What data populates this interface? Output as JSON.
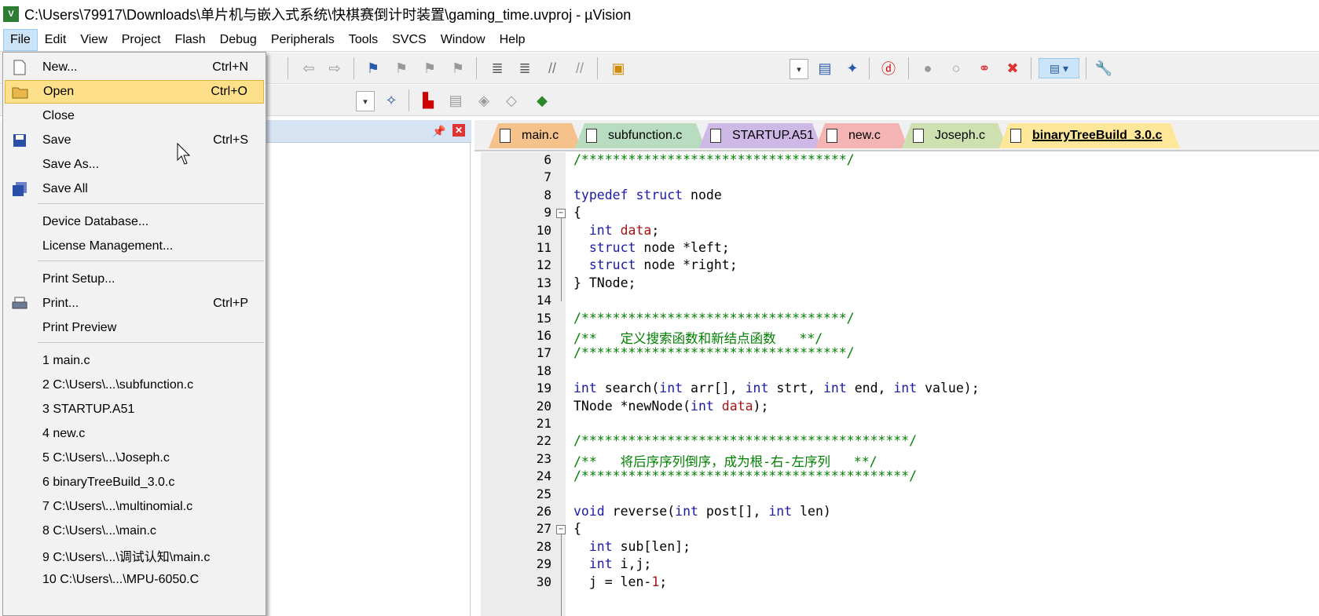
{
  "window": {
    "title": "C:\\Users\\79917\\Downloads\\单片机与嵌入式系统\\快棋赛倒计时装置\\gaming_time.uvproj - µVision",
    "app_icon": "V"
  },
  "menubar": [
    "File",
    "Edit",
    "View",
    "Project",
    "Flash",
    "Debug",
    "Peripherals",
    "Tools",
    "SVCS",
    "Window",
    "Help"
  ],
  "file_menu": {
    "items": [
      {
        "label": "New...",
        "shortcut": "Ctrl+N",
        "icon": "new-file-icon"
      },
      {
        "label": "Open",
        "shortcut": "Ctrl+O",
        "icon": "open-folder-icon",
        "highlighted": true
      },
      {
        "label": "Close",
        "shortcut": ""
      },
      {
        "label": "Save",
        "shortcut": "Ctrl+S",
        "icon": "save-icon"
      },
      {
        "label": "Save As...",
        "shortcut": ""
      },
      {
        "label": "Save All",
        "shortcut": "",
        "icon": "save-all-icon"
      },
      {
        "label": "Device Database...",
        "shortcut": ""
      },
      {
        "label": "License Management...",
        "shortcut": ""
      },
      {
        "label": "Print Setup...",
        "shortcut": ""
      },
      {
        "label": "Print...",
        "shortcut": "Ctrl+P",
        "icon": "printer-icon"
      },
      {
        "label": "Print Preview",
        "shortcut": ""
      },
      {
        "label": "1 main.c"
      },
      {
        "label": "2 C:\\Users\\...\\subfunction.c"
      },
      {
        "label": "3 STARTUP.A51"
      },
      {
        "label": "4 new.c"
      },
      {
        "label": "5 C:\\Users\\...\\Joseph.c"
      },
      {
        "label": "6 binaryTreeBuild_3.0.c"
      },
      {
        "label": "7 C:\\Users\\...\\multinomial.c"
      },
      {
        "label": "8 C:\\Users\\...\\main.c"
      },
      {
        "label": "9 C:\\Users\\...\\调试认知\\main.c"
      },
      {
        "label": "10 C:\\Users\\...\\MPU-6050.C"
      }
    ]
  },
  "editor": {
    "tabs": [
      {
        "label": "main.c",
        "color": "#f6c28b"
      },
      {
        "label": "subfunction.c",
        "color": "#b8dcc0"
      },
      {
        "label": "STARTUP.A51",
        "color": "#cdb8e6"
      },
      {
        "label": "new.c",
        "color": "#f4b4b4"
      },
      {
        "label": "Joseph.c",
        "color": "#cfe0b0"
      },
      {
        "label": "binaryTreeBuild_3.0.c",
        "color": "#ffe79a",
        "active": true
      }
    ],
    "lines": [
      {
        "n": "6",
        "text": "/**********************************/"
      },
      {
        "n": "7",
        "text": ""
      },
      {
        "n": "8",
        "text": "typedef struct node"
      },
      {
        "n": "9",
        "text": "{"
      },
      {
        "n": "10",
        "text": "  int data;"
      },
      {
        "n": "11",
        "text": "  struct node *left;"
      },
      {
        "n": "12",
        "text": "  struct node *right;"
      },
      {
        "n": "13",
        "text": "} TNode;"
      },
      {
        "n": "14",
        "text": ""
      },
      {
        "n": "15",
        "text": "/**********************************/"
      },
      {
        "n": "16",
        "text": "/**   定义搜索函数和新结点函数   **/"
      },
      {
        "n": "17",
        "text": "/**********************************/"
      },
      {
        "n": "18",
        "text": ""
      },
      {
        "n": "19",
        "text": "int search(int arr[], int strt, int end, int value);"
      },
      {
        "n": "20",
        "text": "TNode *newNode(int data);"
      },
      {
        "n": "21",
        "text": ""
      },
      {
        "n": "22",
        "text": "/******************************************/"
      },
      {
        "n": "23",
        "text": "/**   将后序序列倒序，成为根-右-左序列   **/"
      },
      {
        "n": "24",
        "text": "/******************************************/"
      },
      {
        "n": "25",
        "text": ""
      },
      {
        "n": "26",
        "text": "void reverse(int post[], int len)"
      },
      {
        "n": "27",
        "text": "{"
      },
      {
        "n": "28",
        "text": "  int sub[len];"
      },
      {
        "n": "29",
        "text": "  int i,j;"
      },
      {
        "n": "30",
        "text": "  j = len-1;"
      }
    ]
  }
}
